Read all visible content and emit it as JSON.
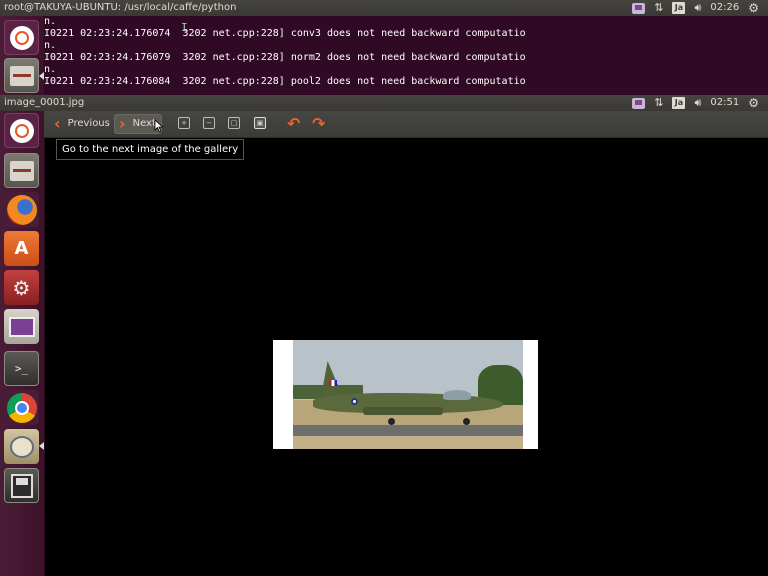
{
  "terminal_panel": {
    "title": "root@TAKUYA-UBUNTU: /usr/local/caffe/python",
    "keyboard": "Ja",
    "time": "02:26"
  },
  "terminal": {
    "lines": [
      "n.",
      "I0221 02:23:24.176074  3202 net.cpp:228] conv3 does not need backward computatio",
      "n.",
      "I0221 02:23:24.176079  3202 net.cpp:228] norm2 does not need backward computatio",
      "n.",
      "I0221 02:23:24.176084  3202 net.cpp:228] pool2 does not need backward computatio"
    ]
  },
  "viewer_panel": {
    "title": "image_0001.jpg",
    "keyboard": "Ja",
    "time": "02:51"
  },
  "toolbar": {
    "previous_label": "Previous",
    "next_label": "Next"
  },
  "tooltip": {
    "text": "Go to the next image of the gallery"
  },
  "launcher": {
    "items": [
      "dash-home",
      "files",
      "firefox",
      "software-center",
      "system-settings",
      "remote-desktop",
      "terminal",
      "chrome",
      "image-viewer",
      "save"
    ]
  }
}
